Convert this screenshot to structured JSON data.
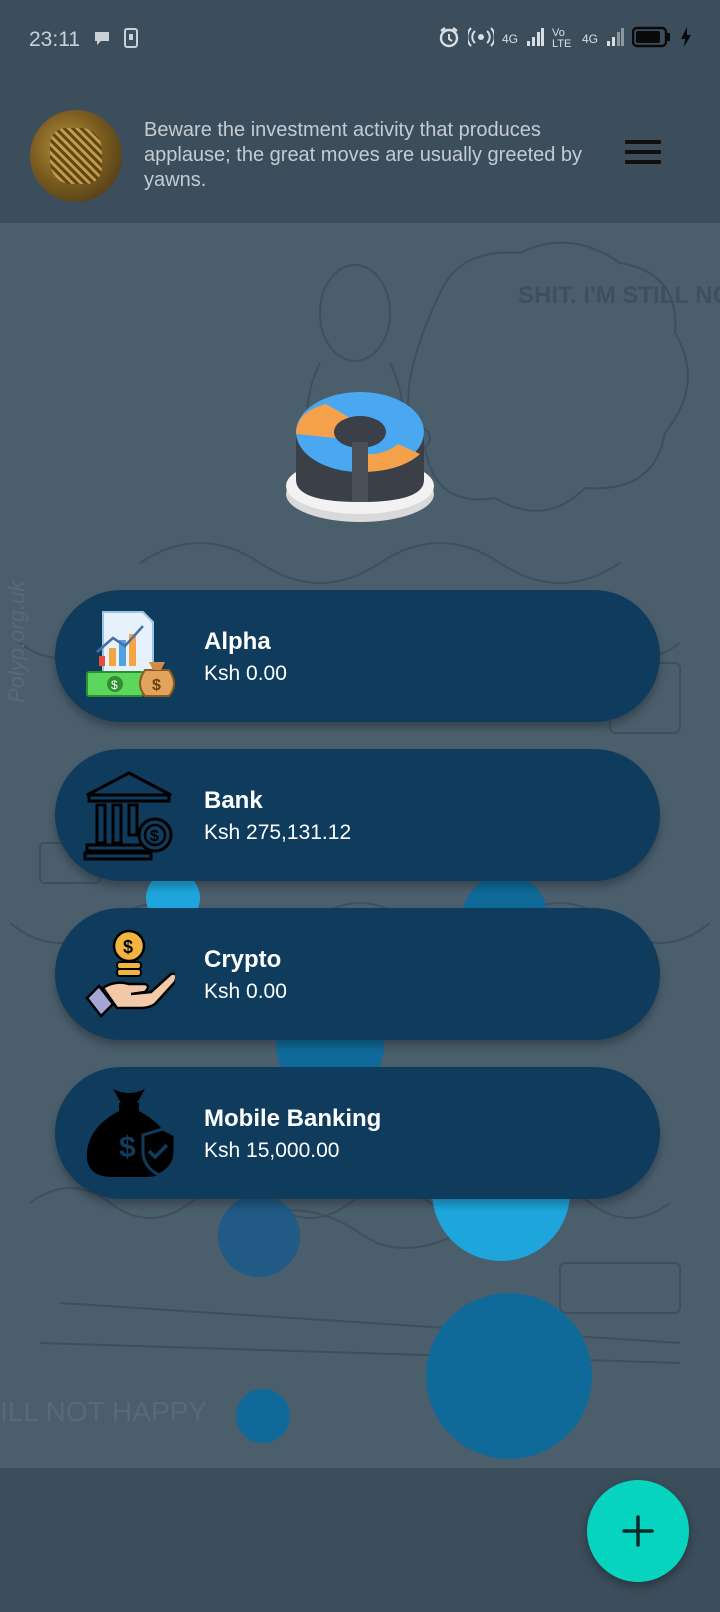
{
  "status_bar": {
    "time": "23:11",
    "network_1": "4G",
    "network_2": "Vo LTE",
    "network_3": "4G"
  },
  "header": {
    "quote": "Beware the investment activity that produces applause; the great moves are usually greeted by yawns."
  },
  "background": {
    "thought_bubble_text": "SHIT. I'M STILL NOT HAPPY...",
    "bottom_caption": "ILL NOT HAPPY",
    "side_credit": "Polyp.org.uk"
  },
  "accounts": [
    {
      "name": "Alpha",
      "amount": "Ksh 0.00",
      "icon": "investment-chart-money-icon"
    },
    {
      "name": "Bank",
      "amount": "Ksh 275,131.12",
      "icon": "bank-building-icon"
    },
    {
      "name": "Crypto",
      "amount": "Ksh 0.00",
      "icon": "hand-coin-icon"
    },
    {
      "name": "Mobile Banking",
      "amount": "Ksh 15,000.00",
      "icon": "money-bag-shield-icon"
    }
  ],
  "fab": {
    "label": "+"
  },
  "colors": {
    "card": "#0f3b5d",
    "fab": "#07d4bf",
    "header": "#3c4e5c",
    "content": "#4a5e6c"
  }
}
